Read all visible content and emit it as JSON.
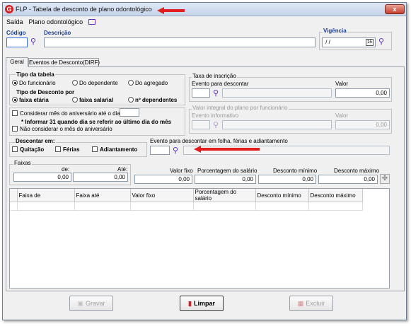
{
  "window": {
    "logo": "G",
    "title": "FLP - Tabela de desconto de plano odontológico",
    "close": "x"
  },
  "menu": {
    "items": [
      "Saída",
      "Plano odontológico"
    ]
  },
  "header": {
    "codigo_label": "Código",
    "descricao_label": "Descrição",
    "vigencia_label": "Vigência",
    "vigencia_value": " / /",
    "calendar_text": "15"
  },
  "tabs": [
    "Geral",
    "Eventos de Desconto(DIRF)"
  ],
  "tipo_tabela": {
    "title": "Tipo da tabela",
    "options": [
      "Do funcionário",
      "Do dependente",
      "Do agregado"
    ],
    "selected": 0
  },
  "tipo_desconto": {
    "title": "Tipo de Desconto por",
    "options": [
      "faixa etária",
      "faixa salarial",
      "nº dependentes"
    ],
    "selected": 0
  },
  "aniversario": {
    "option1": "Considerar mês do aniversário até o dia",
    "note": "* Informar 31 quando dia se referir ao último dia do mês",
    "option2": "Não considerar o mês do aniversário"
  },
  "taxa": {
    "title": "Taxa de inscrição",
    "evento_label": "Evento para descontar",
    "valor_label": "Valor",
    "valor": "0,00"
  },
  "valor_integral": {
    "title": "Valor integral do plano por funcionário",
    "evento_label": "Evento informativo",
    "valor_label": "Valor",
    "valor": "0,00"
  },
  "descontar": {
    "title": "Descontar em:",
    "options": [
      "Quitação",
      "Férias",
      "Adiantamento"
    ]
  },
  "evento_folha": {
    "label": "Evento para descontar em folha, férias e adiantamento"
  },
  "faixas": {
    "title": "Faixas",
    "de_label": "de:",
    "ate_label": "Até:",
    "de_value": "0,00",
    "ate_value": "0,00",
    "valor_fixo_label": "Valor fixo",
    "valor_fixo": "0,00",
    "porcentagem_label": "Porcentagem do salário",
    "porcentagem": "0,00",
    "desc_min_label": "Desconto mínimo",
    "desc_min": "0,00",
    "desc_max_label": "Desconto máximo",
    "desc_max": "0,00"
  },
  "grid": {
    "columns": [
      "Faixa de",
      "Faixa até",
      "Valor fixo",
      "Porcentagem do salário",
      "Desconto mínimo",
      "Desconto máximo"
    ]
  },
  "buttons": {
    "gravar": "Gravar",
    "limpar": "Limpar",
    "excluir": "Excluir"
  },
  "colors": {
    "accent": "#1d3e8c",
    "arrow": "#e11d1d",
    "search_icon": "#5a2db8"
  },
  "icons": {
    "search": "magnifier-icon",
    "calendar": "calendar-icon",
    "monitor": "monitor-icon",
    "eraser": "eraser-icon",
    "save": "disk-icon",
    "delete": "trash-icon"
  }
}
